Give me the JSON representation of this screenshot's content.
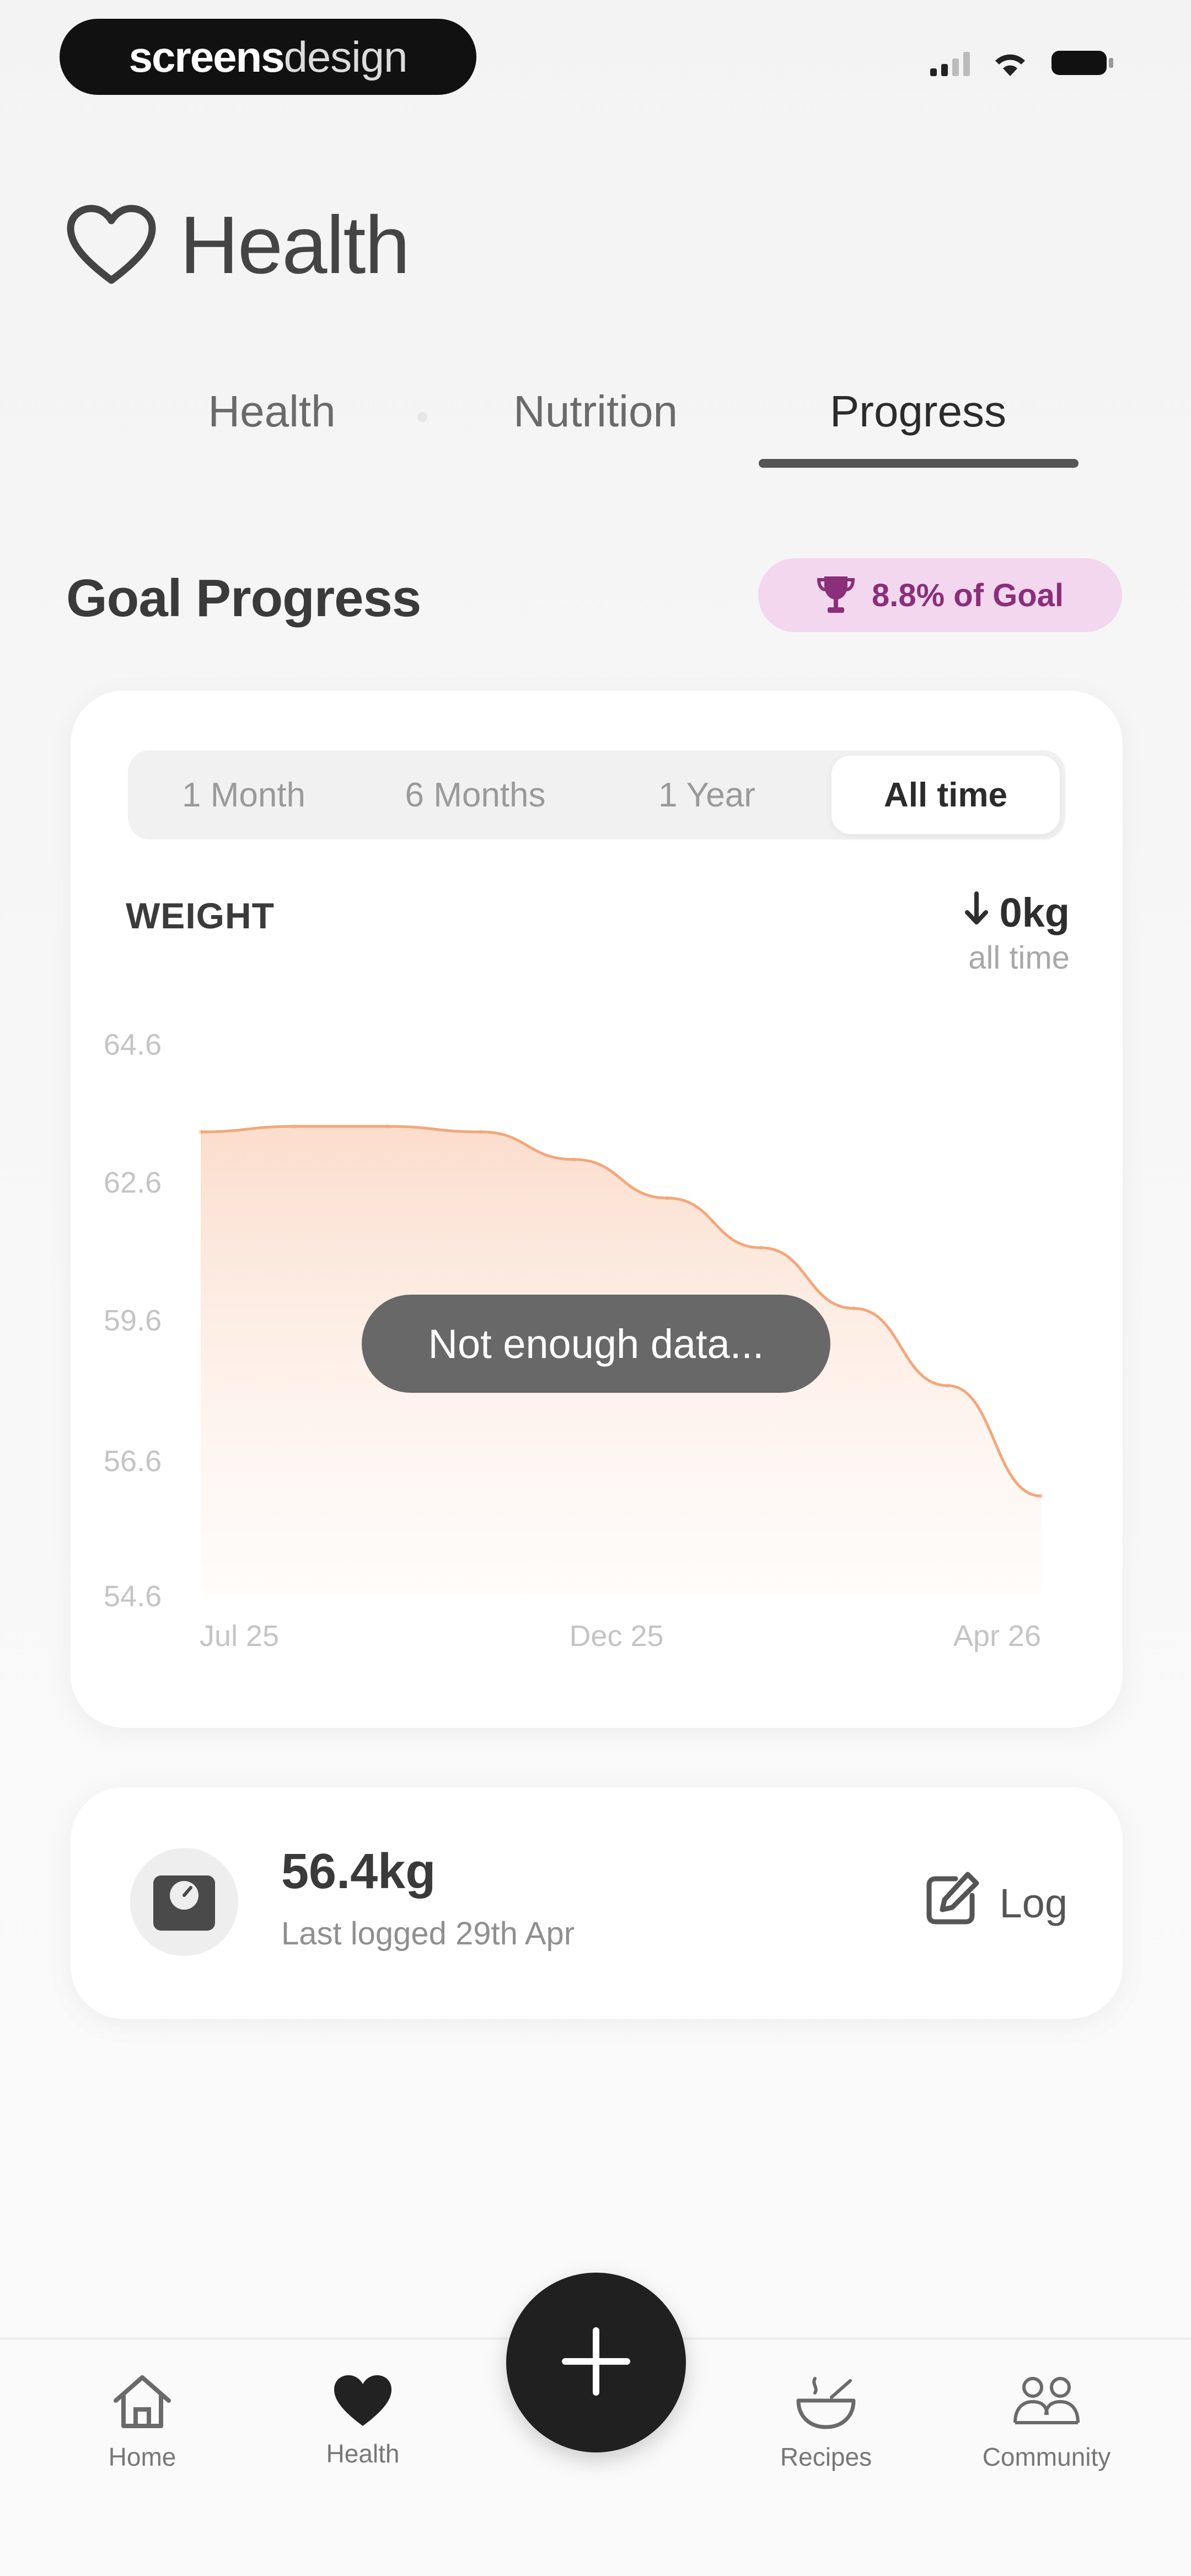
{
  "brand": {
    "part1": "screens",
    "part2": "design"
  },
  "header": {
    "title": "Health"
  },
  "tabs": [
    {
      "label": "Health"
    },
    {
      "label": "Nutrition"
    },
    {
      "label": "Progress"
    }
  ],
  "active_tab": "Progress",
  "goal": {
    "title": "Goal Progress",
    "badge": "8.8% of Goal"
  },
  "ranges": [
    {
      "label": "1 Month"
    },
    {
      "label": "6 Months"
    },
    {
      "label": "1 Year"
    },
    {
      "label": "All time"
    }
  ],
  "active_range": "All time",
  "metric": {
    "label": "WEIGHT",
    "change": "0kg",
    "change_period": "all time"
  },
  "chart_data": {
    "type": "area",
    "title": "",
    "xlabel": "",
    "ylabel": "",
    "x_ticks": [
      "Jul 25",
      "Dec 25",
      "Apr 26"
    ],
    "y_ticks": [
      64.6,
      62.6,
      59.6,
      56.6,
      54.6
    ],
    "x": [
      "Jul 25",
      "Aug 25",
      "Sep 25",
      "Oct 25",
      "Nov 25",
      "Dec 25",
      "Jan 26",
      "Feb 26",
      "Mar 26",
      "Apr 26"
    ],
    "values": [
      63.0,
      63.1,
      63.1,
      63.0,
      62.5,
      61.8,
      60.9,
      59.8,
      58.4,
      56.4
    ],
    "ylim": [
      54.6,
      64.6
    ],
    "grid": false,
    "empty_message": "Not enough data...",
    "color": "#f3a77b"
  },
  "log": {
    "weight": "56.4kg",
    "last_logged": "Last logged 29th Apr",
    "action": "Log"
  },
  "nav": [
    {
      "label": "Home",
      "icon": "home-icon"
    },
    {
      "label": "Health",
      "icon": "heart-icon"
    },
    {
      "label": "Recipes",
      "icon": "bowl-icon"
    },
    {
      "label": "Community",
      "icon": "people-icon"
    }
  ],
  "colors": {
    "accent": "#202020",
    "badge_bg": "#f3d7ee",
    "badge_text": "#8a2f7a"
  }
}
